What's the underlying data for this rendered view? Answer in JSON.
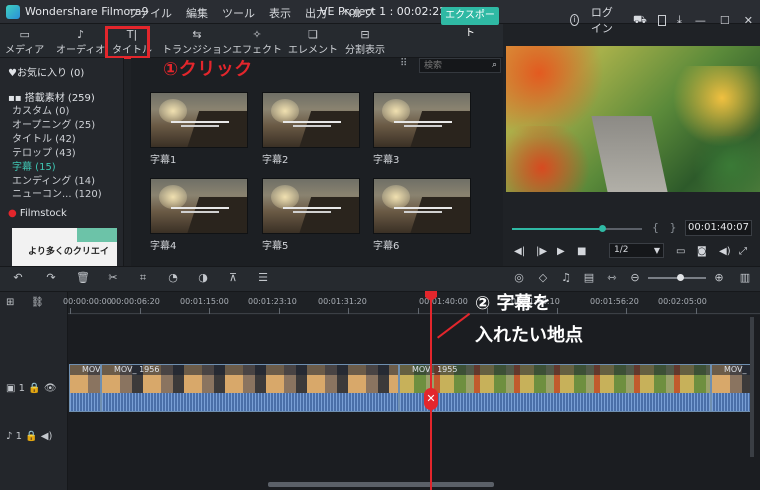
{
  "titlebar": {
    "app_title": "Wondershare Filmora9",
    "menu": [
      "ファイル",
      "編集",
      "ツール",
      "表示",
      "出力",
      "ヘルプ"
    ],
    "project": "VE Project 1 : 00:02:22:13",
    "login": "ログイン"
  },
  "toolbar": {
    "tabs": [
      "メディア",
      "オーディオ",
      "タイトル",
      "トランジション",
      "エフェクト",
      "エレメント",
      "分割表示"
    ],
    "export": "エクスポート"
  },
  "library": {
    "favorites": "♥お気に入り (0)",
    "section": "搭載素材 (259)",
    "items": [
      "カスタム (0)",
      "オープニング (25)",
      "タイトル (42)",
      "テロップ (43)",
      "字幕 (15)",
      "エンディング (14)",
      "ニューコン... (120)"
    ],
    "active_index": 4,
    "filmstock": "Filmstock",
    "filmstock_thumb_text": "より多くのクリエイ"
  },
  "media": {
    "search_placeholder": "検索",
    "thumbs": [
      "字幕1",
      "字幕2",
      "字幕3",
      "字幕4",
      "字幕5",
      "字幕6"
    ]
  },
  "annotations": {
    "step1": "①クリック",
    "step2": "② 字幕を",
    "step2b": "入れたい地点"
  },
  "player": {
    "timecode": "00:01:40:07",
    "ratio": "1/2",
    "progress_fraction": 0.69
  },
  "timeline": {
    "ruler": [
      "00:00:00:00",
      "00:00:06:20",
      "00:01:15:00",
      "00:01:23:10",
      "00:01:31:20",
      "00:01:40:00",
      "00:01:48:10",
      "00:01:56:20",
      "00:02:05:00"
    ],
    "clips": [
      "MOV_ 1956",
      "MOV_ 1956",
      "MOV_ 1955",
      "MOV_"
    ],
    "video_track": "1",
    "audio_track": "1"
  },
  "colors": {
    "accent": "#2fb9a4",
    "annotation_red": "#e3262c"
  }
}
